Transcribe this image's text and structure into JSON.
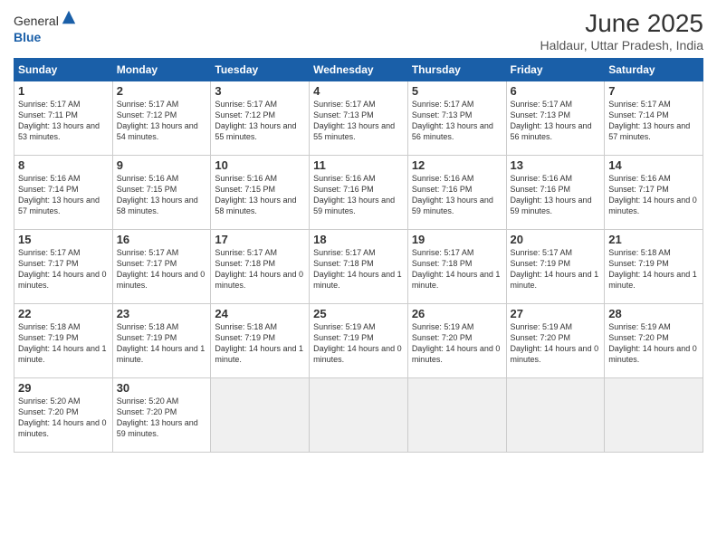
{
  "header": {
    "logo_general": "General",
    "logo_blue": "Blue",
    "title": "June 2025",
    "subtitle": "Haldaur, Uttar Pradesh, India"
  },
  "calendar": {
    "days_of_week": [
      "Sunday",
      "Monday",
      "Tuesday",
      "Wednesday",
      "Thursday",
      "Friday",
      "Saturday"
    ],
    "weeks": [
      [
        null,
        {
          "day": "2",
          "sunrise": "5:17 AM",
          "sunset": "7:12 PM",
          "daylight": "13 hours and 54 minutes."
        },
        {
          "day": "3",
          "sunrise": "5:17 AM",
          "sunset": "7:12 PM",
          "daylight": "13 hours and 55 minutes."
        },
        {
          "day": "4",
          "sunrise": "5:17 AM",
          "sunset": "7:13 PM",
          "daylight": "13 hours and 55 minutes."
        },
        {
          "day": "5",
          "sunrise": "5:17 AM",
          "sunset": "7:13 PM",
          "daylight": "13 hours and 56 minutes."
        },
        {
          "day": "6",
          "sunrise": "5:17 AM",
          "sunset": "7:13 PM",
          "daylight": "13 hours and 56 minutes."
        },
        {
          "day": "7",
          "sunrise": "5:17 AM",
          "sunset": "7:14 PM",
          "daylight": "13 hours and 57 minutes."
        }
      ],
      [
        {
          "day": "1",
          "sunrise": "5:17 AM",
          "sunset": "7:11 PM",
          "daylight": "13 hours and 53 minutes."
        },
        {
          "day": "9",
          "sunrise": "5:16 AM",
          "sunset": "7:15 PM",
          "daylight": "13 hours and 58 minutes."
        },
        {
          "day": "10",
          "sunrise": "5:16 AM",
          "sunset": "7:15 PM",
          "daylight": "13 hours and 58 minutes."
        },
        {
          "day": "11",
          "sunrise": "5:16 AM",
          "sunset": "7:16 PM",
          "daylight": "13 hours and 59 minutes."
        },
        {
          "day": "12",
          "sunrise": "5:16 AM",
          "sunset": "7:16 PM",
          "daylight": "13 hours and 59 minutes."
        },
        {
          "day": "13",
          "sunrise": "5:16 AM",
          "sunset": "7:16 PM",
          "daylight": "13 hours and 59 minutes."
        },
        {
          "day": "14",
          "sunrise": "5:16 AM",
          "sunset": "7:17 PM",
          "daylight": "14 hours and 0 minutes."
        }
      ],
      [
        {
          "day": "8",
          "sunrise": "5:16 AM",
          "sunset": "7:14 PM",
          "daylight": "13 hours and 57 minutes."
        },
        {
          "day": "16",
          "sunrise": "5:17 AM",
          "sunset": "7:17 PM",
          "daylight": "14 hours and 0 minutes."
        },
        {
          "day": "17",
          "sunrise": "5:17 AM",
          "sunset": "7:18 PM",
          "daylight": "14 hours and 0 minutes."
        },
        {
          "day": "18",
          "sunrise": "5:17 AM",
          "sunset": "7:18 PM",
          "daylight": "14 hours and 1 minute."
        },
        {
          "day": "19",
          "sunrise": "5:17 AM",
          "sunset": "7:18 PM",
          "daylight": "14 hours and 1 minute."
        },
        {
          "day": "20",
          "sunrise": "5:17 AM",
          "sunset": "7:19 PM",
          "daylight": "14 hours and 1 minute."
        },
        {
          "day": "21",
          "sunrise": "5:18 AM",
          "sunset": "7:19 PM",
          "daylight": "14 hours and 1 minute."
        }
      ],
      [
        {
          "day": "15",
          "sunrise": "5:17 AM",
          "sunset": "7:17 PM",
          "daylight": "14 hours and 0 minutes."
        },
        {
          "day": "23",
          "sunrise": "5:18 AM",
          "sunset": "7:19 PM",
          "daylight": "14 hours and 1 minute."
        },
        {
          "day": "24",
          "sunrise": "5:18 AM",
          "sunset": "7:19 PM",
          "daylight": "14 hours and 1 minute."
        },
        {
          "day": "25",
          "sunrise": "5:19 AM",
          "sunset": "7:19 PM",
          "daylight": "14 hours and 0 minutes."
        },
        {
          "day": "26",
          "sunrise": "5:19 AM",
          "sunset": "7:20 PM",
          "daylight": "14 hours and 0 minutes."
        },
        {
          "day": "27",
          "sunrise": "5:19 AM",
          "sunset": "7:20 PM",
          "daylight": "14 hours and 0 minutes."
        },
        {
          "day": "28",
          "sunrise": "5:19 AM",
          "sunset": "7:20 PM",
          "daylight": "14 hours and 0 minutes."
        }
      ],
      [
        {
          "day": "22",
          "sunrise": "5:18 AM",
          "sunset": "7:19 PM",
          "daylight": "14 hours and 1 minute."
        },
        {
          "day": "30",
          "sunrise": "5:20 AM",
          "sunset": "7:20 PM",
          "daylight": "13 hours and 59 minutes."
        },
        null,
        null,
        null,
        null,
        null
      ],
      [
        {
          "day": "29",
          "sunrise": "5:20 AM",
          "sunset": "7:20 PM",
          "daylight": "14 hours and 0 minutes."
        },
        null,
        null,
        null,
        null,
        null,
        null
      ]
    ]
  }
}
